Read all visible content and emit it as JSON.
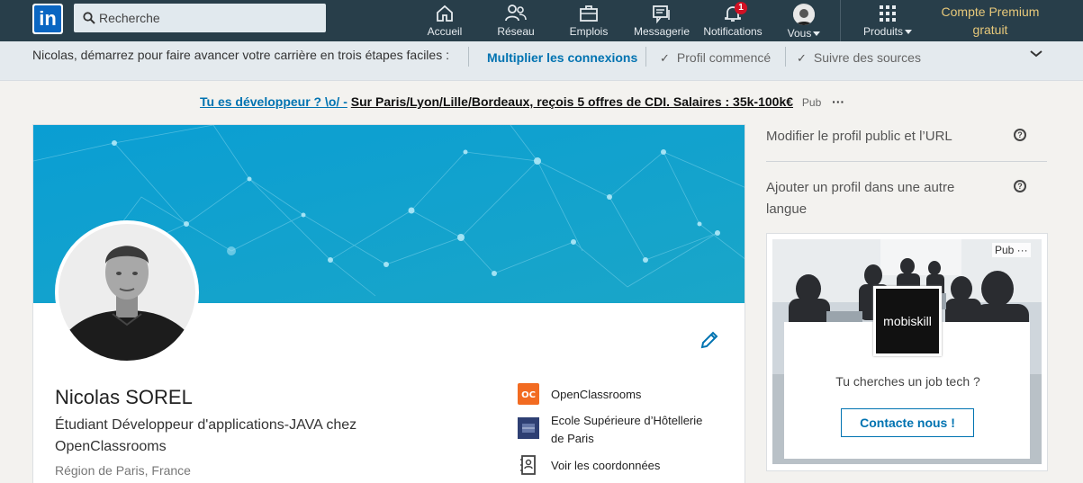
{
  "nav": {
    "search_placeholder": "Recherche",
    "items": [
      {
        "label": "Accueil",
        "icon": "home-icon"
      },
      {
        "label": "Réseau",
        "icon": "network-icon"
      },
      {
        "label": "Emplois",
        "icon": "jobs-icon"
      },
      {
        "label": "Messagerie",
        "icon": "messaging-icon"
      },
      {
        "label": "Notifications",
        "icon": "bell-icon",
        "badge": "1"
      },
      {
        "label": "Vous",
        "icon": "avatar"
      },
      {
        "label": "Produits",
        "icon": "grid-icon"
      }
    ],
    "premium": [
      "Compte Premium",
      "gratuit"
    ]
  },
  "onboarding": {
    "text": "Nicolas, démarrez pour faire avancer votre carrière en trois étapes faciles :",
    "steps": [
      "Multiplier les connexions",
      "Profil commencé",
      "Suivre des sources"
    ]
  },
  "top_ad": {
    "part1": "Tu es développeur ? \\o/ -",
    "part2": "Sur Paris/Lyon/Lille/Bordeaux, reçois 5 offres de CDI. Salaires : 35k-100k€",
    "pub": "Pub",
    "more": "···"
  },
  "profile": {
    "name": "Nicolas SOREL",
    "headline": "Étudiant Développeur d'applications-JAVA chez OpenClassrooms",
    "location": "Région de Paris, France",
    "sidebar": [
      {
        "label": "OpenClassrooms",
        "icon": "openclassrooms-logo"
      },
      {
        "label": "Ecole Supérieure d'Hôtellerie de Paris",
        "label_lines": [
          "Ecole Supérieure d’Hôtellerie",
          "de Paris"
        ],
        "icon": "school-logo"
      },
      {
        "label": "Voir les coordonnées",
        "icon": "contact-card-icon"
      }
    ]
  },
  "right": {
    "edit_public_profile": "Modifier le profil public et l’URL",
    "add_language": [
      "Ajouter un profil dans une autre",
      "langue"
    ],
    "ad": {
      "pub": "Pub ···",
      "brand": "mobiskill",
      "text": "Tu cherches un job tech ?",
      "cta": "Contacte nous !"
    }
  },
  "colors": {
    "nav_bg": "#283e4a",
    "link": "#0073b1",
    "banner_top": "#0a9ed3",
    "banner_bottom": "#16a2c9",
    "premium": "#e7c87a"
  }
}
